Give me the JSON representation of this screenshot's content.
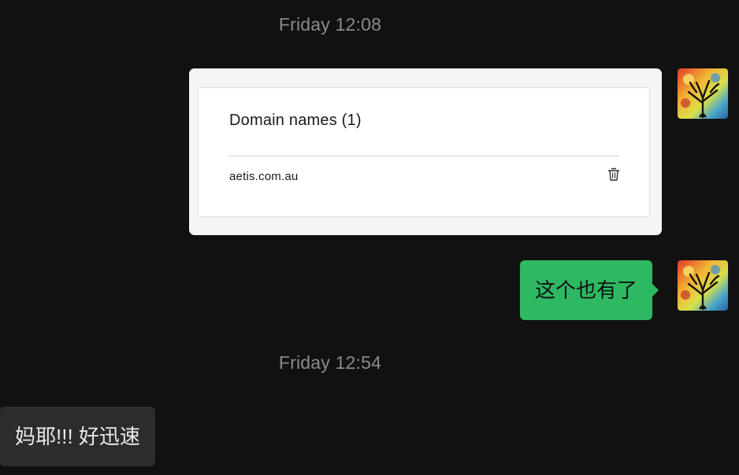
{
  "messages": {
    "timestamp_1": "Friday 12:08",
    "timestamp_2": "Friday 12:54",
    "image_message": {
      "card_title": "Domain names (1)",
      "domain": "aetis.com.au",
      "delete_icon": "trash-icon"
    },
    "sent_text": "这个也有了",
    "received_text": "妈耶!!!  好迅速"
  },
  "colors": {
    "background": "#111111",
    "sent_bubble": "#2eb862",
    "received_bubble": "#2c2c2c",
    "timestamp": "#8a8a8a"
  },
  "avatar": {
    "icon": "tree-of-life-avatar"
  }
}
